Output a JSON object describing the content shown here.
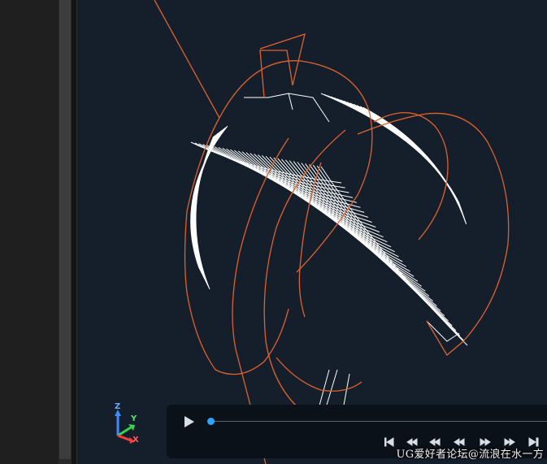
{
  "viewport": {
    "background": "#141f2b",
    "toolpath_color": "#ffffff",
    "cutter_path_color": "#e0622d"
  },
  "triad": {
    "x": "X",
    "y": "Y",
    "z": "Z",
    "x_color": "#ff3b3b",
    "y_color": "#39d353",
    "z_color": "#3b8bff"
  },
  "playback": {
    "progress": 0.0,
    "icons": [
      "play-icon",
      "to-start-icon",
      "step-back-y-icon",
      "step-back-xy-icon",
      "step-back-z-icon",
      "step-forward-icon",
      "to-end-icon"
    ]
  },
  "watermark": "UG爱好者论坛@流浪在水一方"
}
